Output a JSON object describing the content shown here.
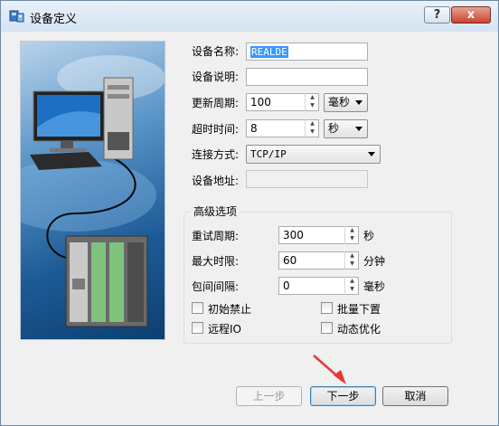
{
  "window": {
    "title": "设备定义",
    "help_glyph": "?",
    "close_glyph": "x"
  },
  "form": {
    "name_label": "设备名称:",
    "name_value": "REALDE",
    "desc_label": "设备说明:",
    "desc_value": "",
    "update_label": "更新周期:",
    "update_value": "100",
    "update_unit": "毫秒",
    "timeout_label": "超时时间:",
    "timeout_value": "8",
    "timeout_unit": "秒",
    "conn_label": "连接方式:",
    "conn_value": "TCP/IP",
    "addr_label": "设备地址:",
    "addr_value": ""
  },
  "advanced": {
    "title": "高级选项",
    "retry_label": "重试周期:",
    "retry_value": "300",
    "retry_unit": "秒",
    "maxtime_label": "最大时限:",
    "maxtime_value": "60",
    "maxtime_unit": "分钟",
    "gap_label": "包间间隔:",
    "gap_value": "0",
    "gap_unit": "毫秒",
    "checkboxes": [
      {
        "label": "初始禁止",
        "checked": false
      },
      {
        "label": "批量下置",
        "checked": false
      },
      {
        "label": "远程IO",
        "checked": false
      },
      {
        "label": "动态优化",
        "checked": false
      }
    ]
  },
  "buttons": {
    "prev": "上一步",
    "next": "下一步",
    "cancel": "取消"
  },
  "colors": {
    "accent_arrow": "#e53935",
    "selection": "#3399ff",
    "illustration": "#1c5a96"
  },
  "icons": {
    "app": "device-config-icon",
    "illustration": "computer-plc-illustration"
  }
}
